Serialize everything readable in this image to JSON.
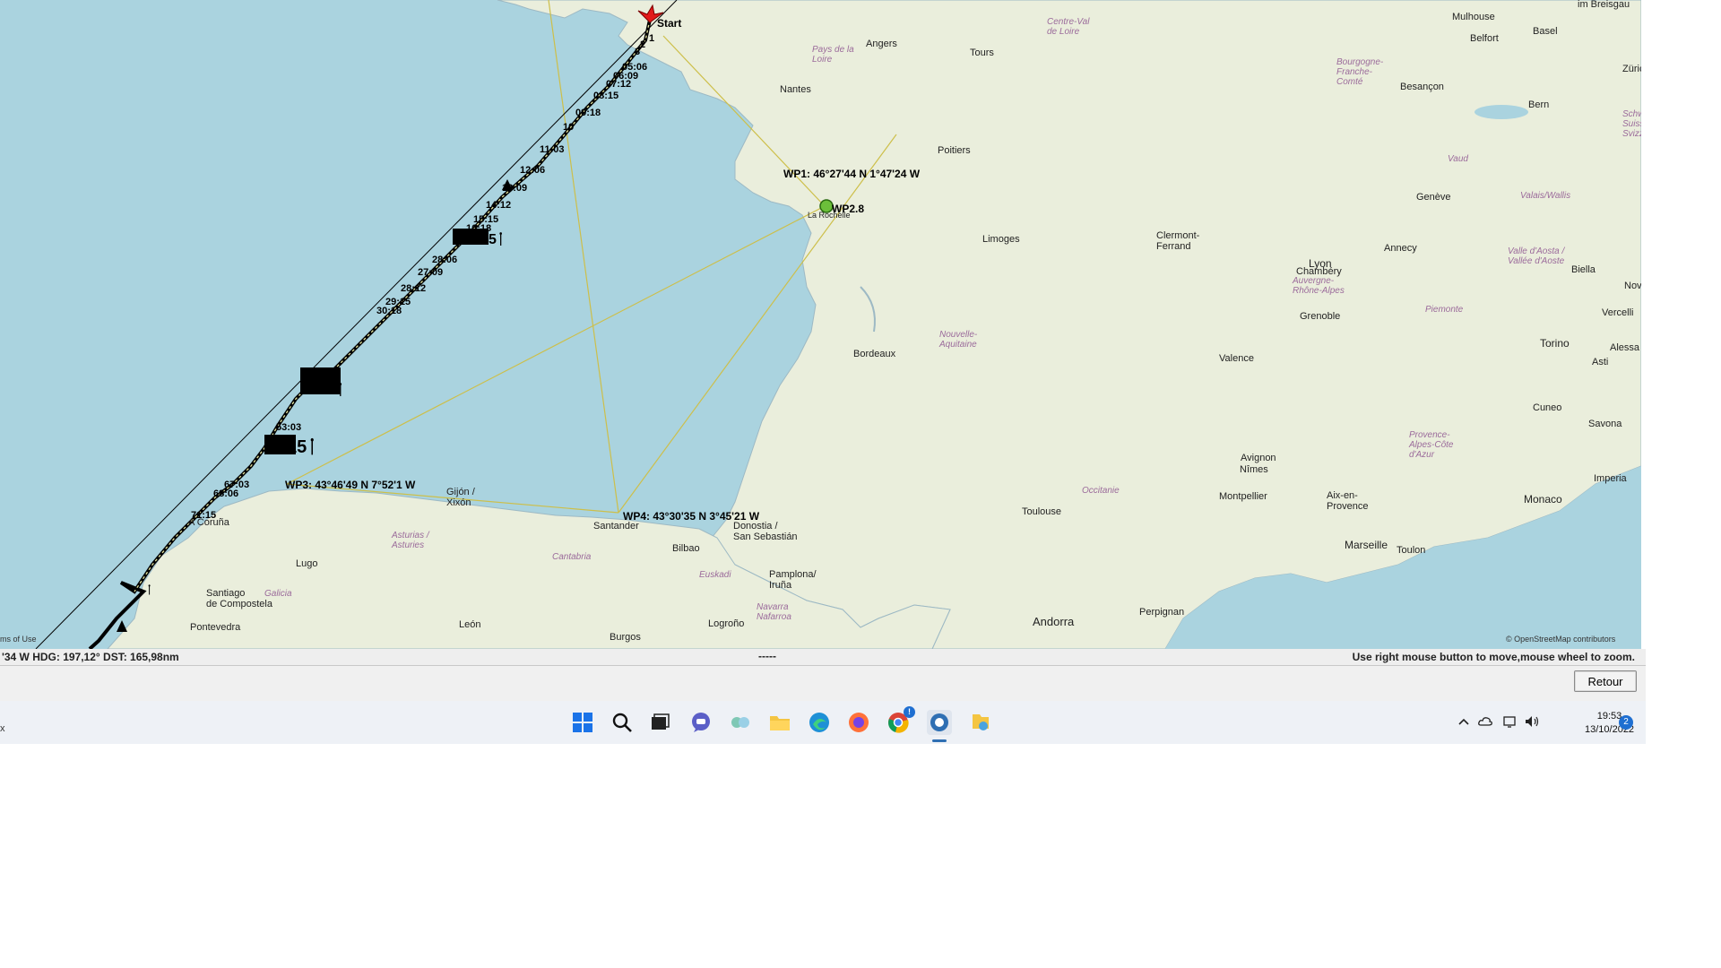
{
  "map": {
    "start_label": "Start",
    "waypoints": [
      {
        "name": "wp1",
        "label": "WP1: 46°27'44 N 1°47'24 W"
      },
      {
        "name": "wp2",
        "label": "WP2.8"
      },
      {
        "name": "wp3",
        "label": "WP3: 43°46'49 N 7°52'1 W"
      },
      {
        "name": "wp4",
        "label": "WP4: 43°30'35 N 3°45'21 W"
      }
    ],
    "route_time_labels": [
      "1",
      "2",
      "3",
      "05:06",
      "06:09",
      "07:12",
      "08:15",
      "09:18",
      "10",
      "11:03",
      "12:06",
      "13:09",
      "14:12",
      "15:15",
      "16:18",
      "27:09",
      "28:06",
      "28:12",
      "29:15",
      "30:18",
      "53:03",
      "67:03",
      "68:06",
      "71:15"
    ],
    "places": {
      "nantes": "Nantes",
      "angers": "Angers",
      "tours": "Tours",
      "poitiers": "Poitiers",
      "la_rochelle": "La Rochelle",
      "limoges": "Limoges",
      "bordeaux": "Bordeaux",
      "toulouse": "Toulouse",
      "clermont_ferrand": "Clermont-\nFerrand",
      "lyon": "Lyon",
      "grenoble": "Grenoble",
      "valence": "Valence",
      "avignon": "Avignon",
      "nimes": "Nîmes",
      "montpellier": "Montpellier",
      "aix": "Aix-en-\nProvence",
      "marseille": "Marseille",
      "toulon": "Toulon",
      "monaco": "Monaco",
      "perpignan": "Perpignan",
      "andorra": "Andorra",
      "chambery": "Chambéry",
      "annecy": "Annecy",
      "geneve": "Genève",
      "bern": "Bern",
      "besancon": "Besançon",
      "mulhouse": "Mulhouse",
      "basel": "Basel",
      "belfort": "Belfort",
      "torino": "Torino",
      "cuneo": "Cuneo",
      "savona": "Savona",
      "asti": "Asti",
      "imperia": "Imperia",
      "biella": "Biella",
      "vercelli": "Vercelli",
      "alessa": "Alessa",
      "novi": "Nov",
      "zurich": "Zürich",
      "im_breisgau": "im Breisgau",
      "a_coruna": "A Coruña",
      "lugo": "Lugo",
      "santiago": "Santiago\nde Compostela",
      "pontevedra": "Pontevedra",
      "gijon": "Gijón /\nXixón",
      "santander": "Santander",
      "bilbao": "Bilbao",
      "san_sebastian": "Donostia /\nSan Sebastián",
      "pamplona": "Pamplona/\nIruña",
      "logrono": "Logroño",
      "leon": "León",
      "burgos": "Burgos"
    },
    "regions": {
      "pays_de_la_loire": "Pays de la\nLoire",
      "centre_val": "Centre-Val\nde Loire",
      "bourgogne": "Bourgogne-\nFranche-\nComté",
      "nouvelle_aquitaine": "Nouvelle-\nAquitaine",
      "auvergne": "Auvergne-\nRhône-Alpes",
      "occitanie": "Occitanie",
      "provence": "Provence-\nAlpes-Côte\nd'Azur",
      "piemonte": "Piemonte",
      "vaud": "Vaud",
      "valais": "Valais/Wallis",
      "valle_aosta": "Valle d'Aosta /\nVallée d'Aoste",
      "schweiz": "Schwei\nSuisse/Svi\nSvizz",
      "asturias": "Asturias /\nAsturies",
      "cantabria": "Cantabria",
      "euskadi": "Euskadi",
      "navarra": "Navarra\nNafarroa",
      "galicia": "Galicia"
    },
    "attribution": "© OpenStreetMap contributors",
    "terms": "ms of Use"
  },
  "status": {
    "left": "'34 W HDG: 197,12° DST: 165,98nm",
    "middle": "-----",
    "right": "Use right mouse button to move,mouse wheel to zoom."
  },
  "retour_label": "Retour",
  "taskbar": {
    "time": "19:53",
    "date": "13/10/2022",
    "notification_count": "2",
    "chrome_badge": "!",
    "left_stub": "x"
  },
  "colors": {
    "sea": "#aad3df",
    "land": "#e8eedc",
    "route": "#000000",
    "grid_line": "#d4c75a",
    "start_marker": "#e21a1a",
    "taskbar": "#eef1f6"
  }
}
